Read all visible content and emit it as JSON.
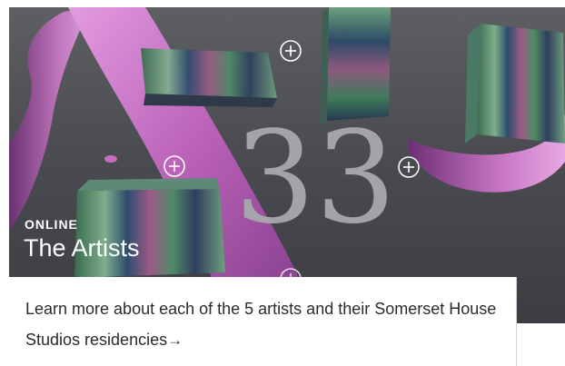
{
  "card": {
    "eyebrow": "ONLINE",
    "title": "The Artists",
    "description": "Learn more about each of the 5 artists and their Somerset House Studios residencies",
    "arrow": "→"
  },
  "artwork": {
    "numeral": "33",
    "icons": [
      "plus-circle-icon",
      "arrow-right-icon"
    ],
    "colors": {
      "background": "#55565b",
      "ribbon": "#c86fc2",
      "numeral": "#a8a9ad"
    }
  }
}
